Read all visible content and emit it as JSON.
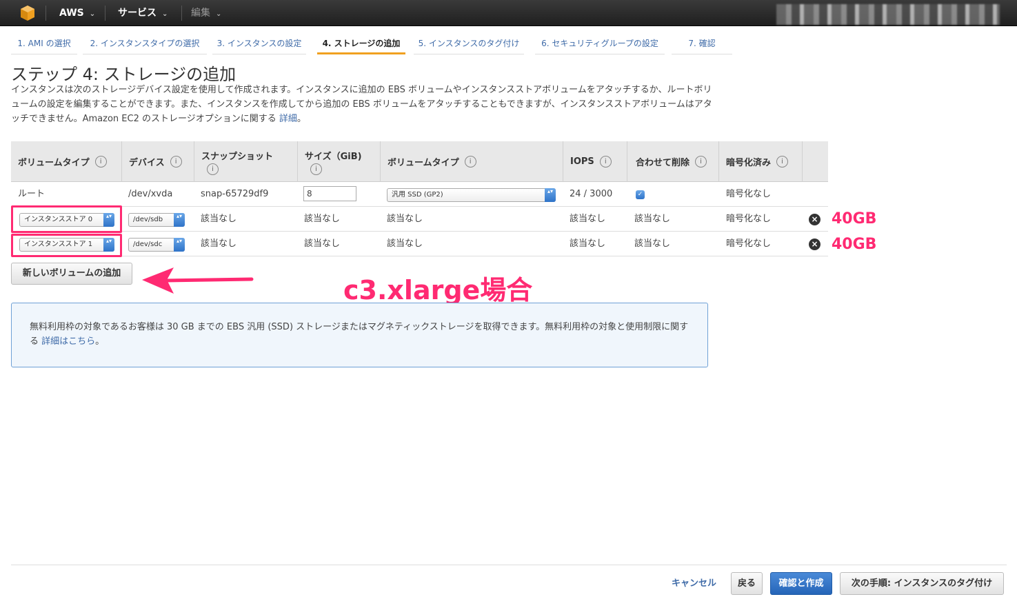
{
  "topnav": {
    "aws": "AWS",
    "services": "サービス",
    "edit": "編集",
    "caret": "⌄"
  },
  "tabs": [
    {
      "label": "1. AMI の選択"
    },
    {
      "label": "2. インスタンスタイプの選択"
    },
    {
      "label": "3. インスタンスの設定"
    },
    {
      "label": "4. ストレージの追加"
    },
    {
      "label": "5. インスタンスのタグ付け"
    },
    {
      "label": "6. セキュリティグループの設定"
    },
    {
      "label": "7. 確認"
    }
  ],
  "page": {
    "title": "ステップ 4: ストレージの追加",
    "description": "インスタンスは次のストレージデバイス設定を使用して作成されます。インスタンスに追加の EBS ボリュームやインスタンスストアボリュームをアタッチするか、ルートボリュームの設定を編集することができます。また、インスタンスを作成してから追加の EBS ボリュームをアタッチすることもできますが、インスタンスストアボリュームはアタッチできません。Amazon EC2 のストレージオプションに関する ",
    "details_link": "詳細",
    "period": "。"
  },
  "table": {
    "headers": {
      "volume_type": "ボリュームタイプ",
      "device": "デバイス",
      "snapshot": "スナップショット",
      "size": "サイズ（GiB)",
      "ebs_type": "ボリュームタイプ",
      "iops": "IOPS",
      "delete_on_term": "合わせて削除",
      "encrypted": "暗号化済み",
      "info_glyph": "i"
    },
    "rows": [
      {
        "type": "ルート",
        "device": "/dev/xvda",
        "snapshot": "snap-65729df9",
        "size": "8",
        "ebs_type": "汎用 SSD (GP2)",
        "iops": "24 / 3000",
        "encrypted": "暗号化なし"
      },
      {
        "type": "インスタンスストア 0",
        "device": "/dev/sdb",
        "snapshot": "該当なし",
        "size": "該当なし",
        "ebs_type": "該当なし",
        "iops": "該当なし",
        "delete": "該当なし",
        "encrypted": "暗号化なし",
        "annotation": "40GB"
      },
      {
        "type": "インスタンスストア 1",
        "device": "/dev/sdc",
        "snapshot": "該当なし",
        "size": "該当なし",
        "ebs_type": "該当なし",
        "iops": "該当なし",
        "delete": "該当なし",
        "encrypted": "暗号化なし",
        "annotation": "40GB"
      }
    ],
    "checkbox_glyph": "✓",
    "remove_glyph": "×",
    "select_arrow": "▴▾"
  },
  "add_volume_button": "新しいボリュームの追加",
  "annotation_label": "c3.xlarge場合",
  "info_box": {
    "text": "無料利用枠の対象であるお客様は 30 GB までの EBS 汎用 (SSD) ストレージまたはマグネティックストレージを取得できます。無料利用枠の対象と使用制限に関する ",
    "link": "詳細はこちら",
    "period": "。"
  },
  "footer": {
    "cancel": "キャンセル",
    "back": "戻る",
    "review_launch": "確認と作成",
    "next": "次の手順: インスタンスのタグ付け"
  },
  "colors": {
    "annotation": "#ff2a72",
    "primary": "#2565b8",
    "link": "#3f6ba8",
    "active_tab": "#f0a020"
  }
}
